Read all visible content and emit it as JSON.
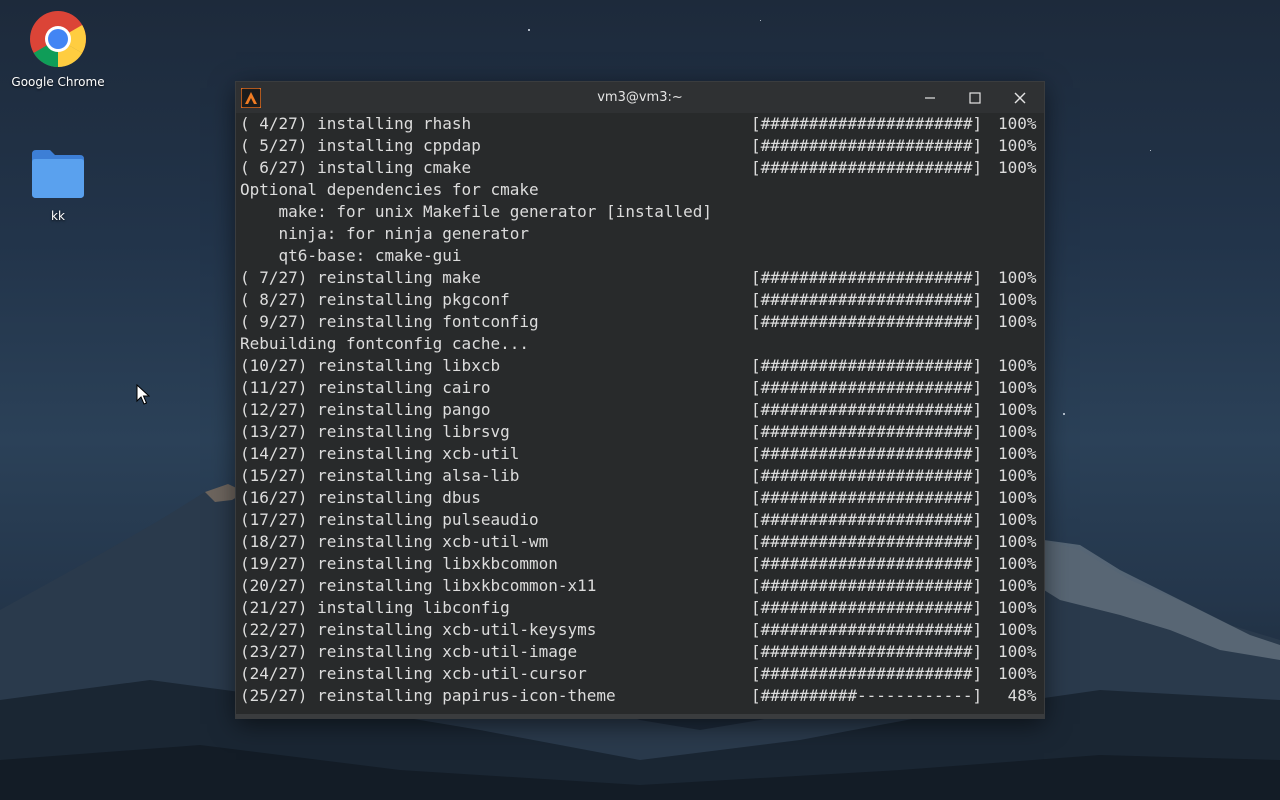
{
  "desktop": {
    "icons": [
      {
        "label": "Google Chrome",
        "icon": "chrome-icon"
      },
      {
        "label": "kk",
        "icon": "folder-icon"
      }
    ]
  },
  "terminal": {
    "title": "vm3@vm3:~",
    "app_icon": "terminal-app-icon",
    "controls": [
      "minimize-icon",
      "maximize-icon",
      "close-icon"
    ],
    "lines": [
      {
        "text": "( 4/27) installing rhash",
        "bar": "[######################]",
        "pct": "100%"
      },
      {
        "text": "( 5/27) installing cppdap",
        "bar": "[######################]",
        "pct": "100%"
      },
      {
        "text": "( 6/27) installing cmake",
        "bar": "[######################]",
        "pct": "100%"
      },
      {
        "text": "Optional dependencies for cmake",
        "bar": "",
        "pct": ""
      },
      {
        "text": "    make: for unix Makefile generator [installed]",
        "bar": "",
        "pct": ""
      },
      {
        "text": "    ninja: for ninja generator",
        "bar": "",
        "pct": ""
      },
      {
        "text": "    qt6-base: cmake-gui",
        "bar": "",
        "pct": ""
      },
      {
        "text": "( 7/27) reinstalling make",
        "bar": "[######################]",
        "pct": "100%"
      },
      {
        "text": "( 8/27) reinstalling pkgconf",
        "bar": "[######################]",
        "pct": "100%"
      },
      {
        "text": "( 9/27) reinstalling fontconfig",
        "bar": "[######################]",
        "pct": "100%"
      },
      {
        "text": "Rebuilding fontconfig cache...",
        "bar": "",
        "pct": ""
      },
      {
        "text": "(10/27) reinstalling libxcb",
        "bar": "[######################]",
        "pct": "100%"
      },
      {
        "text": "(11/27) reinstalling cairo",
        "bar": "[######################]",
        "pct": "100%"
      },
      {
        "text": "(12/27) reinstalling pango",
        "bar": "[######################]",
        "pct": "100%"
      },
      {
        "text": "(13/27) reinstalling librsvg",
        "bar": "[######################]",
        "pct": "100%"
      },
      {
        "text": "(14/27) reinstalling xcb-util",
        "bar": "[######################]",
        "pct": "100%"
      },
      {
        "text": "(15/27) reinstalling alsa-lib",
        "bar": "[######################]",
        "pct": "100%"
      },
      {
        "text": "(16/27) reinstalling dbus",
        "bar": "[######################]",
        "pct": "100%"
      },
      {
        "text": "(17/27) reinstalling pulseaudio",
        "bar": "[######################]",
        "pct": "100%"
      },
      {
        "text": "(18/27) reinstalling xcb-util-wm",
        "bar": "[######################]",
        "pct": "100%"
      },
      {
        "text": "(19/27) reinstalling libxkbcommon",
        "bar": "[######################]",
        "pct": "100%"
      },
      {
        "text": "(20/27) reinstalling libxkbcommon-x11",
        "bar": "[######################]",
        "pct": "100%"
      },
      {
        "text": "(21/27) installing libconfig",
        "bar": "[######################]",
        "pct": "100%"
      },
      {
        "text": "(22/27) reinstalling xcb-util-keysyms",
        "bar": "[######################]",
        "pct": "100%"
      },
      {
        "text": "(23/27) reinstalling xcb-util-image",
        "bar": "[######################]",
        "pct": "100%"
      },
      {
        "text": "(24/27) reinstalling xcb-util-cursor",
        "bar": "[######################]",
        "pct": "100%"
      },
      {
        "text": "(25/27) reinstalling papirus-icon-theme",
        "bar": "[##########------------]",
        "pct": " 48%"
      }
    ]
  },
  "colors": {
    "terminal_bg": "#282a2b",
    "titlebar_bg": "#2f3133",
    "terminal_fg": "#dcdcdc"
  }
}
